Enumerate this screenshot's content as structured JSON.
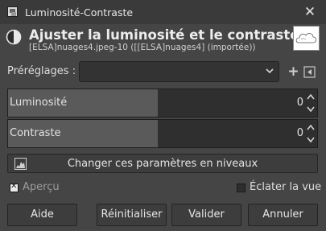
{
  "window": {
    "title": "Luminosité-Contraste",
    "close_icon": "close-icon"
  },
  "header": {
    "title": "Ajuster la luminosité et le contraste",
    "subtitle": "[ELSA]nuages4.jpeg-10 ([[ELSA]nuages4] (importée))",
    "icon": "brightness-contrast-icon"
  },
  "presets": {
    "label": "Préréglages :",
    "value": ""
  },
  "sliders": [
    {
      "label": "Luminosité",
      "value": "0"
    },
    {
      "label": "Contraste",
      "value": "0"
    }
  ],
  "levels_button": {
    "label": "Changer ces paramètres en niveaux",
    "icon": "levels-icon"
  },
  "preview": {
    "label": "Aperçu",
    "checked": true
  },
  "split_view": {
    "label": "Éclater la vue",
    "checked": false
  },
  "buttons": {
    "help": "Aide",
    "reset": "Réinitialiser",
    "ok": "Valider",
    "cancel": "Annuler"
  }
}
